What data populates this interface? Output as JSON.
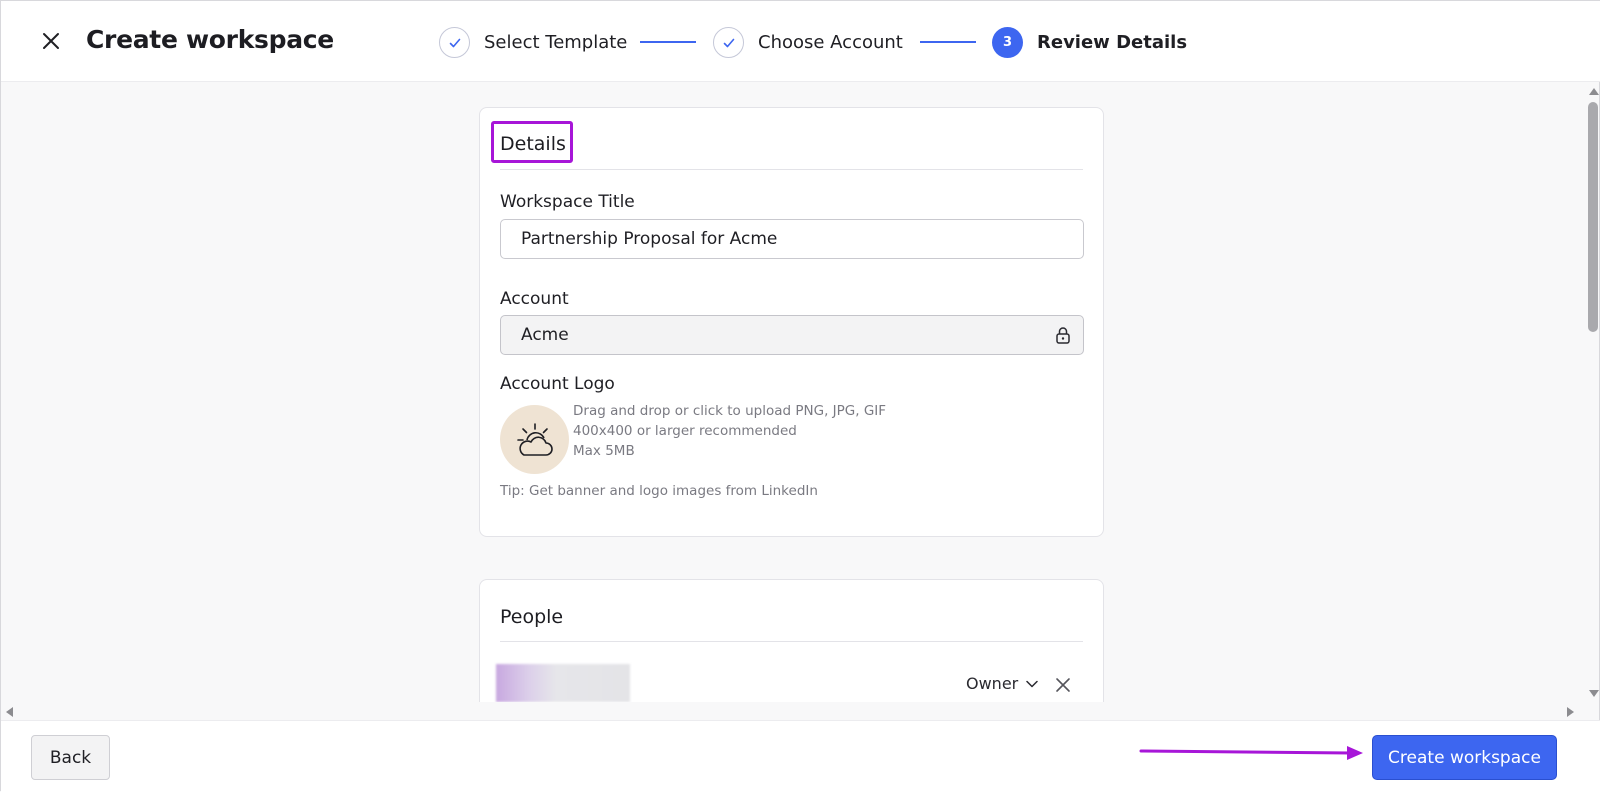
{
  "header": {
    "title": "Create workspace",
    "steps": [
      {
        "label": "Select Template",
        "status": "done"
      },
      {
        "label": "Choose Account",
        "status": "done"
      },
      {
        "label": "Review Details",
        "status": "active",
        "number": "3"
      }
    ]
  },
  "details": {
    "section_title": "Details",
    "workspace_title_label": "Workspace Title",
    "workspace_title_value": "Partnership Proposal for Acme",
    "account_label": "Account",
    "account_value": "Acme",
    "account_logo_label": "Account Logo",
    "upload_lines": [
      "Drag and drop or click to upload PNG, JPG, GIF",
      "400x400 or larger recommended",
      "Max 5MB"
    ],
    "tip": "Tip: Get banner and logo images from LinkedIn"
  },
  "people": {
    "section_title": "People",
    "rows": [
      {
        "role": "Owner"
      }
    ]
  },
  "footer": {
    "back_label": "Back",
    "create_label": "Create workspace"
  },
  "colors": {
    "accent": "#3d66f0",
    "annotation": "#a716d8",
    "logo_background": "#efe3d3"
  }
}
